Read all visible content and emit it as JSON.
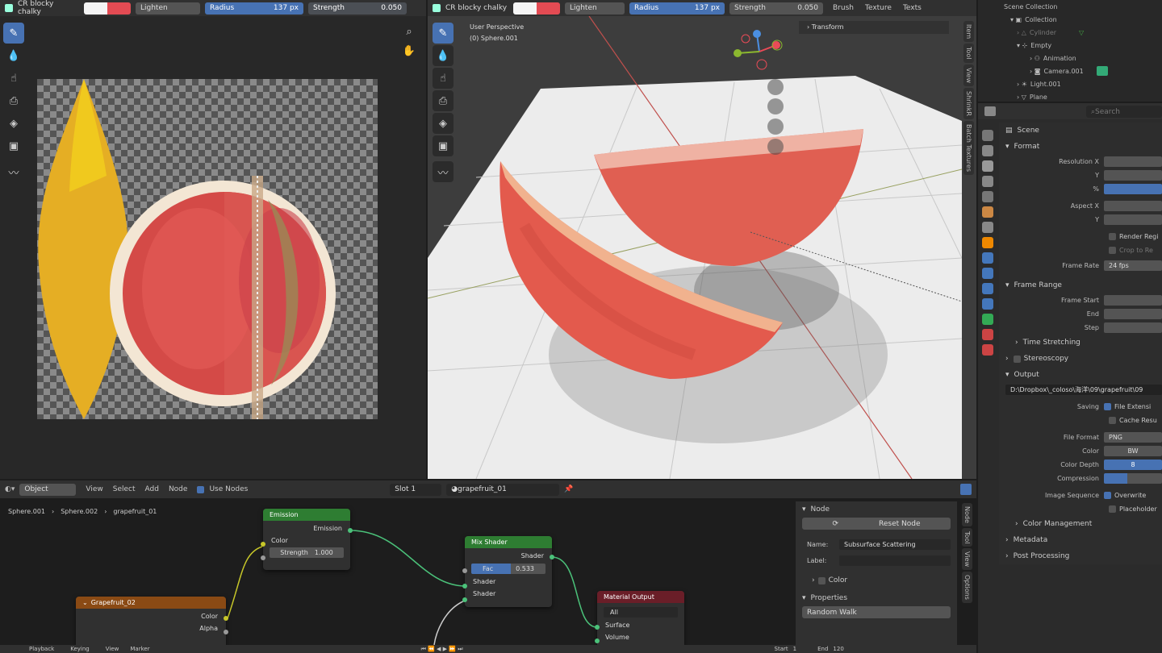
{
  "img_editor": {
    "brush_name": "CR blocky chalky",
    "blend_mode": "Lighten",
    "radius_label": "Radius",
    "radius_value": "137 px",
    "strength_label": "Strength",
    "strength_value": "0.050"
  },
  "viewport": {
    "brush_name": "CR blocky chalky",
    "blend_mode": "Lighten",
    "radius_label": "Radius",
    "radius_value": "137 px",
    "strength_label": "Strength",
    "strength_value": "0.050",
    "menu_brush": "Brush",
    "menu_texture": "Texture",
    "menu_texts": "Texts",
    "perspective": "User Perspective",
    "object": "(0) Sphere.001",
    "transform_panel": "Transform",
    "side_tabs": [
      "Item",
      "Tool",
      "View",
      "ShrinkR",
      "Batch Textures"
    ]
  },
  "outliner": {
    "rows": [
      "Scene Collection",
      "Collection",
      "Cylinder",
      "Empty",
      "Animation",
      "Camera.001",
      "Light.001",
      "Plane"
    ]
  },
  "props": {
    "search_placeholder": "Search",
    "scene_label": "Scene",
    "format_header": "Format",
    "resolution_x": "Resolution X",
    "y1": "Y",
    "pct": "%",
    "aspect_x": "Aspect X",
    "y2": "Y",
    "render_region": "Render Regi",
    "crop": "Crop to Re",
    "frame_rate_label": "Frame Rate",
    "frame_rate_value": "24 fps",
    "frame_range_header": "Frame Range",
    "frame_start": "Frame Start",
    "end": "End",
    "step": "Step",
    "time_stretching": "Time Stretching",
    "stereoscopy": "Stereoscopy",
    "output_header": "Output",
    "output_path": "D:\\Dropbox\\_coloso\\海洋\\09\\grapefruit\\09",
    "saving_label": "Saving",
    "file_ext": "File Extensi",
    "cache_result": "Cache Resu",
    "file_format_label": "File Format",
    "file_format_value": "PNG",
    "color_label": "Color",
    "color_value": "BW",
    "color_depth_label": "Color Depth",
    "color_depth_value": "8",
    "compression_label": "Compression",
    "image_sequence_label": "Image Sequence",
    "overwrite": "Overwrite",
    "placeholders": "Placeholder",
    "color_management": "Color Management",
    "metadata": "Metadata",
    "post_processing": "Post Processing"
  },
  "node_editor": {
    "mode": "Object",
    "menu_view": "View",
    "menu_select": "Select",
    "menu_add": "Add",
    "menu_node": "Node",
    "use_nodes": "Use Nodes",
    "slot": "Slot 1",
    "material": "grapefruit_01",
    "crumb1": "Sphere.001",
    "crumb2": "Sphere.002",
    "crumb3": "grapefruit_01",
    "emission_title": "Emission",
    "emission_out": "Emission",
    "emission_color": "Color",
    "emission_strength_label": "Strength",
    "emission_strength_value": "1.000",
    "mix_title": "Mix Shader",
    "mix_out": "Shader",
    "mix_fac_label": "Fac",
    "mix_fac_value": "0.533",
    "mix_in1": "Shader",
    "mix_in2": "Shader",
    "tex_title": "Grapefruit_02",
    "tex_color": "Color",
    "tex_alpha": "Alpha",
    "out_title": "Material Output",
    "out_target": "All",
    "out_surface": "Surface",
    "out_volume": "Volume"
  },
  "node_panel": {
    "node_header": "Node",
    "reset_node": "Reset Node",
    "name_label": "Name:",
    "name_value": "Subsurface Scattering",
    "label_label": "Label:",
    "color_label": "Color",
    "properties_header": "Properties",
    "method_value": "Random Walk",
    "side_tabs": [
      "Node",
      "Tool",
      "View",
      "Options"
    ]
  },
  "timeline": {
    "playback": "Playback",
    "keying": "Keying",
    "view": "View",
    "marker": "Marker",
    "start": "Start",
    "start_value": "1",
    "end": "End",
    "end_value": "120"
  },
  "colors": {
    "accent": "#4772b3",
    "panel": "#303030",
    "bg": "#1d1d1d",
    "emission_header": "#2e7d32",
    "texture_header": "#8a4a14",
    "output_header": "#6a1e28"
  }
}
